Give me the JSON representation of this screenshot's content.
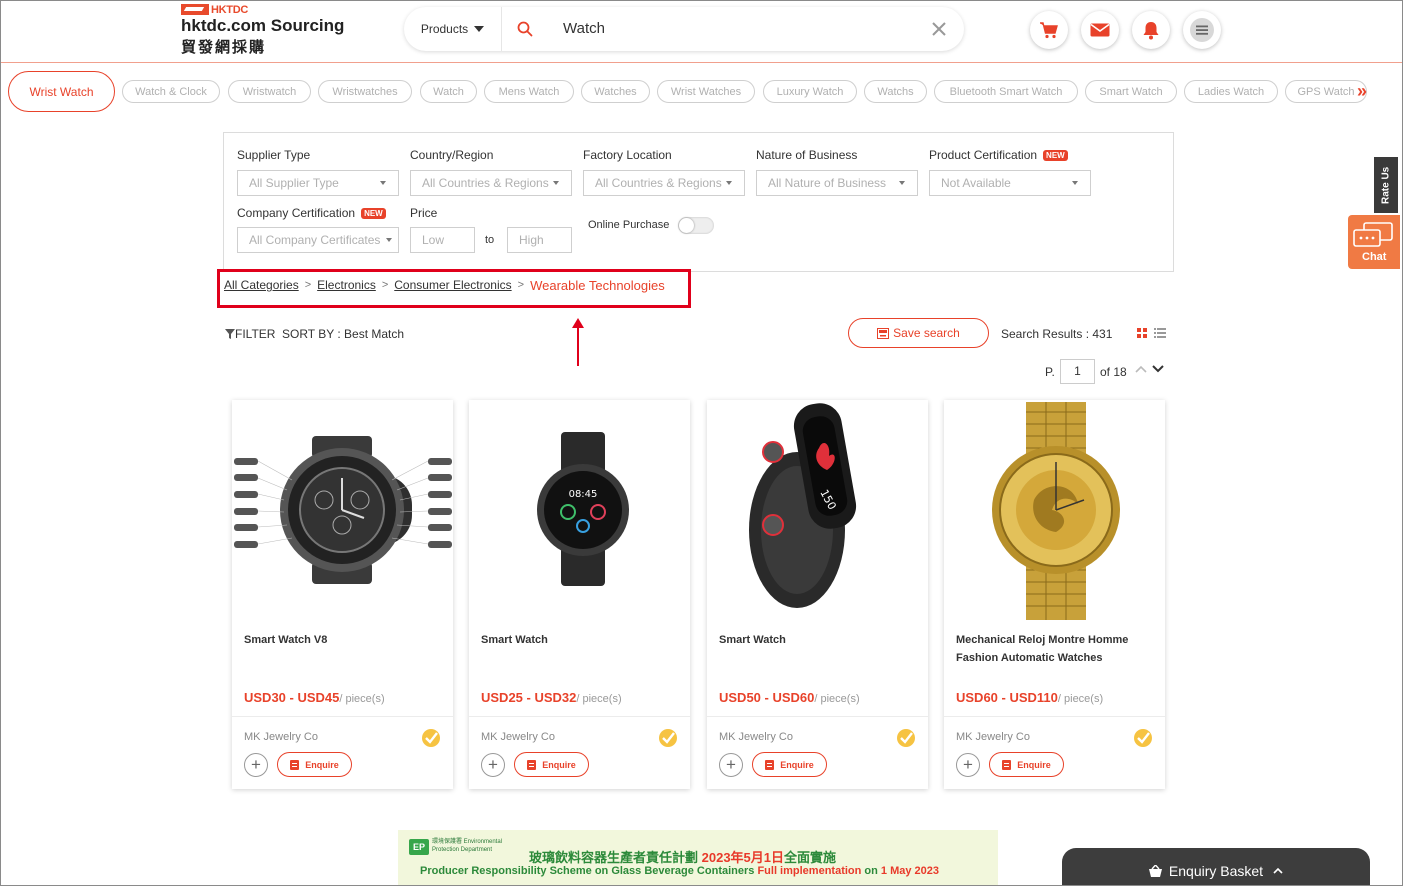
{
  "header": {
    "logo_badge": "HKTDC",
    "logo_title": "hktdc.com Sourcing",
    "logo_subtitle": "貿發網採購",
    "search_category": "Products",
    "search_value": "Watch"
  },
  "tags": [
    {
      "label": "Wrist Watch",
      "active": true
    },
    {
      "label": "Watch & Clock"
    },
    {
      "label": "Wristwatch"
    },
    {
      "label": "Wristwatches"
    },
    {
      "label": "Watch"
    },
    {
      "label": "Mens Watch"
    },
    {
      "label": "Watches"
    },
    {
      "label": "Wrist Watches"
    },
    {
      "label": "Luxury Watch"
    },
    {
      "label": "Watchs"
    },
    {
      "label": "Bluetooth Smart Watch"
    },
    {
      "label": "Smart Watch"
    },
    {
      "label": "Ladies Watch"
    },
    {
      "label": "GPS Watch"
    }
  ],
  "filters": {
    "supplier_type_label": "Supplier Type",
    "supplier_type_value": "All Supplier Type",
    "country_label": "Country/Region",
    "country_value": "All Countries & Regions",
    "factory_label": "Factory Location",
    "factory_value": "All Countries & Regions",
    "nature_label": "Nature of Business",
    "nature_value": "All Nature of Business",
    "product_cert_label": "Product Certification",
    "product_cert_value": "Not Available",
    "company_cert_label": "Company Certification",
    "company_cert_value": "All Company Certificates",
    "price_label": "Price",
    "price_low": "Low",
    "price_to": "to",
    "price_high": "High",
    "online_purchase_label": "Online Purchase",
    "new_badge": "NEW"
  },
  "breadcrumb": {
    "items": [
      "All Categories",
      "Electronics",
      "Consumer Electronics"
    ],
    "current": "Wearable Technologies"
  },
  "toolbar": {
    "filter_label": "FILTER",
    "sort_label": "SORT BY : Best Match",
    "save_search": "Save search",
    "results": "Search Results : 431",
    "page_prefix": "P.",
    "page_current": "1",
    "page_total": "of 18"
  },
  "products": [
    {
      "title": "Smart Watch V8",
      "price": "USD30 - USD45",
      "unit": "/ piece(s)",
      "supplier": "MK Jewelry Co",
      "enquire": "Enquire"
    },
    {
      "title": "Smart Watch",
      "price": "USD25 - USD32",
      "unit": "/ piece(s)",
      "supplier": "MK Jewelry Co",
      "enquire": "Enquire"
    },
    {
      "title": "Smart Watch",
      "price": "USD50 - USD60",
      "unit": "/ piece(s)",
      "supplier": "MK Jewelry Co",
      "enquire": "Enquire"
    },
    {
      "title": "Mechanical Reloj Montre Homme Fashion Automatic Watches",
      "price": "USD60 - USD110",
      "unit": "/ piece(s)",
      "supplier": "MK Jewelry Co",
      "enquire": "Enquire"
    }
  ],
  "side": {
    "rate_us": "Rate Us",
    "chat": "Chat"
  },
  "banner": {
    "zh_a": "玻璃飲料容器生產者責任計劃 ",
    "zh_b": "2023年5月1日",
    "zh_c": "全面實施",
    "en_a": "Producer Responsibility Scheme on Glass Beverage Containers ",
    "en_b": "Full implementation",
    "en_c": " on ",
    "en_d": "1 May 2023",
    "logo_text": "環境保護署 Environmental Protection Department"
  },
  "basket": {
    "label": "Enquiry Basket"
  },
  "colors": {
    "accent": "#e8422a",
    "highlight": "#e0001b"
  }
}
